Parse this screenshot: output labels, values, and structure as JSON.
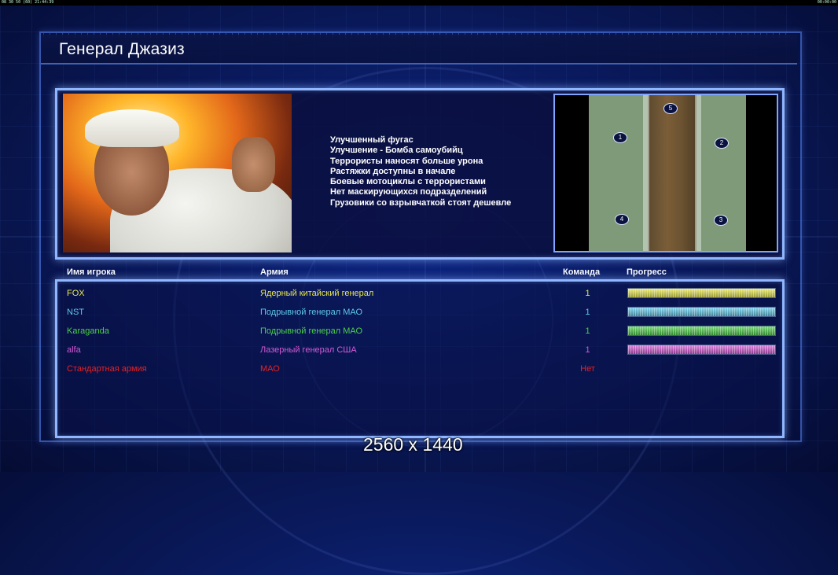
{
  "topbar": {
    "left": "08 30 50 (60) 21:44:39",
    "right": "00:00:00"
  },
  "title": "Генерал Джазиз",
  "features": [
    "Улучшенный фугас",
    "Улучшение - Бомба самоубийц",
    "Террористы наносят больше урона",
    "Растяжки доступны в начале",
    "Боевые мотоциклы с террористами",
    "Нет маскирующихся подразделений",
    "Грузовики со взрывчаткой стоят дешевле"
  ],
  "map": {
    "positions": [
      "1",
      "2",
      "3",
      "4",
      "5"
    ]
  },
  "table": {
    "headers": {
      "name": "Имя игрока",
      "army": "Армия",
      "team": "Команда",
      "progress": "Прогресс"
    },
    "rows": [
      {
        "name": "FOX",
        "army": "Ядерный китайский генерал",
        "team": "1",
        "color": "#e8e850",
        "progress": 1.0
      },
      {
        "name": "NST",
        "army": "Подрывной генерал МАО",
        "team": "1",
        "color": "#5fc8e8",
        "progress": 1.0
      },
      {
        "name": "Karaganda",
        "army": "Подрывной генерал МАО",
        "team": "1",
        "color": "#4ed04a",
        "progress": 1.0
      },
      {
        "name": "alfa",
        "army": "Лазерный генерал США",
        "team": "1",
        "color": "#d45ad4",
        "progress": 1.0
      },
      {
        "name": "Стандартная армия",
        "army": "МАО",
        "team": "Нет",
        "color": "#e82020",
        "progress": null
      }
    ]
  },
  "resolution": "2560 x 1440",
  "colors": {
    "background": "#0a1a5e",
    "frame": "#8fb6ff"
  }
}
